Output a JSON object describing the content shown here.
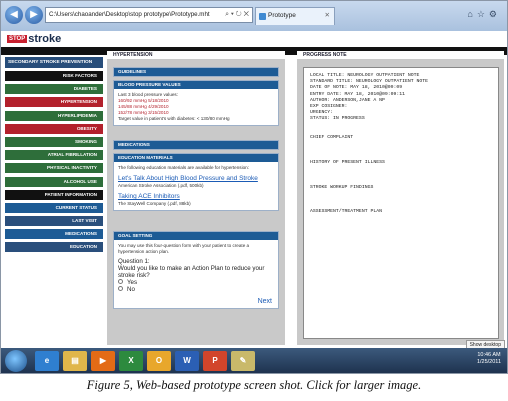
{
  "browser": {
    "address": "C:\\Users\\chaoander\\Desktop\\stop prototype\\Prototype.mht",
    "tab_label": "Prototype",
    "back_icon": "back-arrow-icon",
    "forward_icon": "forward-arrow-icon"
  },
  "logo": {
    "stop": "STOP",
    "stroke": "stroke"
  },
  "sidebar": {
    "title": "SECONDARY STROKE PREVENTION",
    "items": [
      {
        "label": "RISK FACTORS",
        "color": "black"
      },
      {
        "label": "DIABETES",
        "color": "green"
      },
      {
        "label": "HYPERTENSION",
        "color": "red"
      },
      {
        "label": "HYPERLIPIDEMIA",
        "color": "green"
      },
      {
        "label": "OBESITY",
        "color": "red"
      },
      {
        "label": "SMOKING",
        "color": "green"
      },
      {
        "label": "ATRIAL FIBRILLATION",
        "color": "green"
      },
      {
        "label": "PHYSICAL INACTIVITY",
        "color": "green"
      },
      {
        "label": "ALCOHOL USE",
        "color": "green"
      },
      {
        "label": "PATIENT INFORMATION",
        "color": "black"
      },
      {
        "label": "CURRENT STATUS",
        "color": "blue"
      },
      {
        "label": "LAST VISIT",
        "color": "blue"
      },
      {
        "label": "MEDICATIONS",
        "color": "blue"
      },
      {
        "label": "EDUCATION",
        "color": "blue"
      }
    ]
  },
  "middle": {
    "heading": "HYPERTENSION",
    "guidelines": "GUIDELINES",
    "bp": {
      "title": "BLOOD PRESSURE VALUES",
      "intro": "Last 3 blood pressure values:",
      "rows": [
        "160/92 mmHg   5/18/2010",
        "145/88 mmHg   4/29/2010",
        "152/78 mmHg   3/15/2010"
      ],
      "target": "Target value in patient's with diabetes: < 130/80 mmHg"
    },
    "medications": "MEDICATIONS",
    "education": {
      "title": "EDUCATION MATERIALS",
      "intro": "The following education materials are available for hypertension:",
      "link1": "Let's Talk About High Blood Pressure and Stroke",
      "src1": "American Stroke Association (.pdf, 500kb)",
      "link2": "Taking ACE Inhibitors",
      "src2": "The StayWell Company (.pdf, 88kb)"
    },
    "goal": {
      "title": "GOAL SETTING",
      "intro": "You may use this four-question form with your patient to create a hypertension action plan.",
      "qnum": "Question 1:",
      "question": "Would you like to make an Action Plan to reduce your stroke risk?",
      "yes": "Yes",
      "no": "No",
      "next": "Next"
    }
  },
  "right": {
    "heading": "PROGRESS NOTE",
    "note": "LOCAL TITLE: NEUROLOGY OUTPATIENT NOTE\nSTANDARD TITLE: NEUROLOGY OUTPATIENT NOTE\nDATE OF NOTE: MAY 18, 2010@09:09\nENTRY DATE: MAY 18, 2010@09:09:11\nAUTHOR: ANDERSON,JANE A NP\nEXP COSIGNER:\nURGENCY:\nSTATUS: IN PROGRESS\n\n\nCHIEF COMPLAINT\n\n\n\nHISTORY OF PRESENT ILLNESS\n\n\n\nSTROKE WORKUP FINDINGS\n\n\n\nASSESSMENT/TREATMENT PLAN"
  },
  "taskbar": {
    "show_desktop": "Show desktop",
    "time": "10:46 AM",
    "date": "1/25/2011"
  },
  "caption": "Figure 5, Web-based prototype screen shot.  Click for larger image."
}
